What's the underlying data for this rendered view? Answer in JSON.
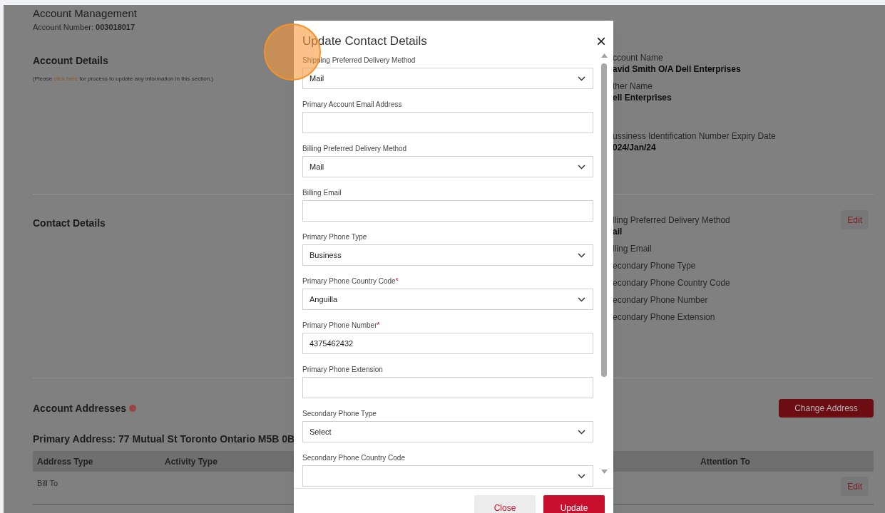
{
  "page": {
    "title": "Account Management",
    "account_number": "Account Number: **003018017**"
  },
  "account_details": {
    "heading": "Account Details",
    "note_before": "(Please ",
    "note_link": "click here",
    "note_after": " for process to update any information in this section.)",
    "groups": [
      [
        {
          "label": "ccount Name",
          "value": "avid Smith O/A Dell Enterprises"
        },
        {
          "label": "ther Name",
          "value": "ell Enterprises"
        }
      ],
      [
        {
          "label": "ussiness Identification Number Expiry Date",
          "value": "024/Jan/24"
        }
      ]
    ]
  },
  "contact_details": {
    "heading": "Contact Details",
    "edit": "Edit",
    "fields": [
      {
        "label": "lling Preferred Delivery Method",
        "value": "ail"
      },
      {
        "label": "lling Email"
      },
      {
        "label": "econdary Phone Type"
      },
      {
        "label": "econdary Phone Country Code"
      },
      {
        "label": "econdary Phone Number"
      },
      {
        "label": "econdary Phone Extension"
      }
    ]
  },
  "addresses": {
    "heading": "Account Addresses",
    "button": "Change Address",
    "primary": "Primary Address: 77 Mutual St Toronto Ontario M5B 0B",
    "columns": [
      "Address Type",
      "Activity Type",
      "Attention To"
    ],
    "rows": [
      {
        "cells": [
          "Bill To",
          "",
          ""
        ],
        "edit": "Edit"
      }
    ]
  },
  "modal": {
    "title": "Update Contact Details",
    "close_icon": "×",
    "fields": [
      {
        "kind": "select",
        "label": "Shipping Preferred Delivery Method",
        "value": "Mail"
      },
      {
        "kind": "input",
        "label": "Primary Account Email Address"
      },
      {
        "kind": "select",
        "label": "Billing Preferred Delivery Method",
        "value": "Mail"
      },
      {
        "kind": "input",
        "label": "Billing Email"
      },
      {
        "kind": "select",
        "label": "Primary Phone Type",
        "value": "Business"
      },
      {
        "kind": "select",
        "label": "Primary Phone Country Code",
        "required_mark": "*",
        "value": "Anguilla"
      },
      {
        "kind": "input",
        "label": "Primary Phone Number",
        "required_mark": "*",
        "value": "4375462432"
      },
      {
        "kind": "input",
        "label": "Primary Phone Extension"
      },
      {
        "kind": "select",
        "label": "Secondary Phone Type",
        "value": "Select"
      },
      {
        "kind": "select",
        "label": "Secondary Phone Country Code"
      }
    ],
    "buttons": [
      {
        "kind": "secondary",
        "label": "Close"
      },
      {
        "kind": "primary",
        "label": "Update"
      }
    ]
  }
}
